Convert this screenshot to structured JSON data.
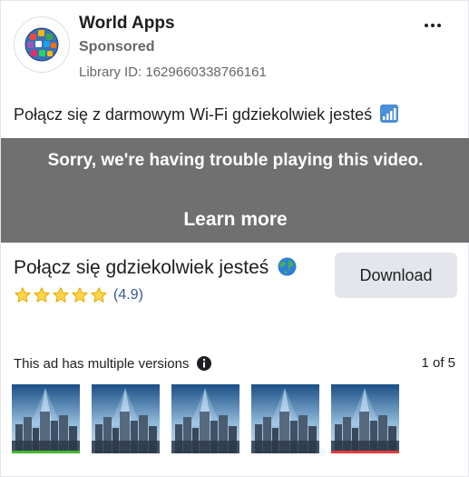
{
  "header": {
    "advertiser": "World Apps",
    "sponsored": "Sponsored",
    "library_id": "Library ID: 1629660338766161",
    "avatar_icon": "globe-apps-icon",
    "more_icon": "more-options-icon"
  },
  "body": {
    "primary_text": "Połącz się z darmowym Wi-Fi gdziekolwiek jesteś",
    "primary_text_icon": "signal-bars-icon"
  },
  "video": {
    "error_message": "Sorry, we're having trouble playing this video.",
    "learn_more": "Learn more",
    "background_color": "#707070"
  },
  "cta": {
    "headline": "Połącz się gdziekolwiek jesteś",
    "headline_icon": "globe-icon",
    "rating_value": 4.9,
    "rating_text": "(4.9)",
    "stars": 5,
    "star_icon": "star-icon",
    "button_label": "Download"
  },
  "versions": {
    "label": "This ad has multiple versions",
    "info_icon": "info-icon",
    "pager": "1 of 5",
    "thumbnails": [
      {
        "name": "version-1",
        "bar_color": "#42b72a"
      },
      {
        "name": "version-2",
        "bar_color": ""
      },
      {
        "name": "version-3",
        "bar_color": ""
      },
      {
        "name": "version-4",
        "bar_color": ""
      },
      {
        "name": "version-5",
        "bar_color": "#e4383b"
      }
    ]
  },
  "colors": {
    "link": "#385898",
    "secondary_text": "#65676b",
    "button_bg": "#e4e6eb"
  }
}
